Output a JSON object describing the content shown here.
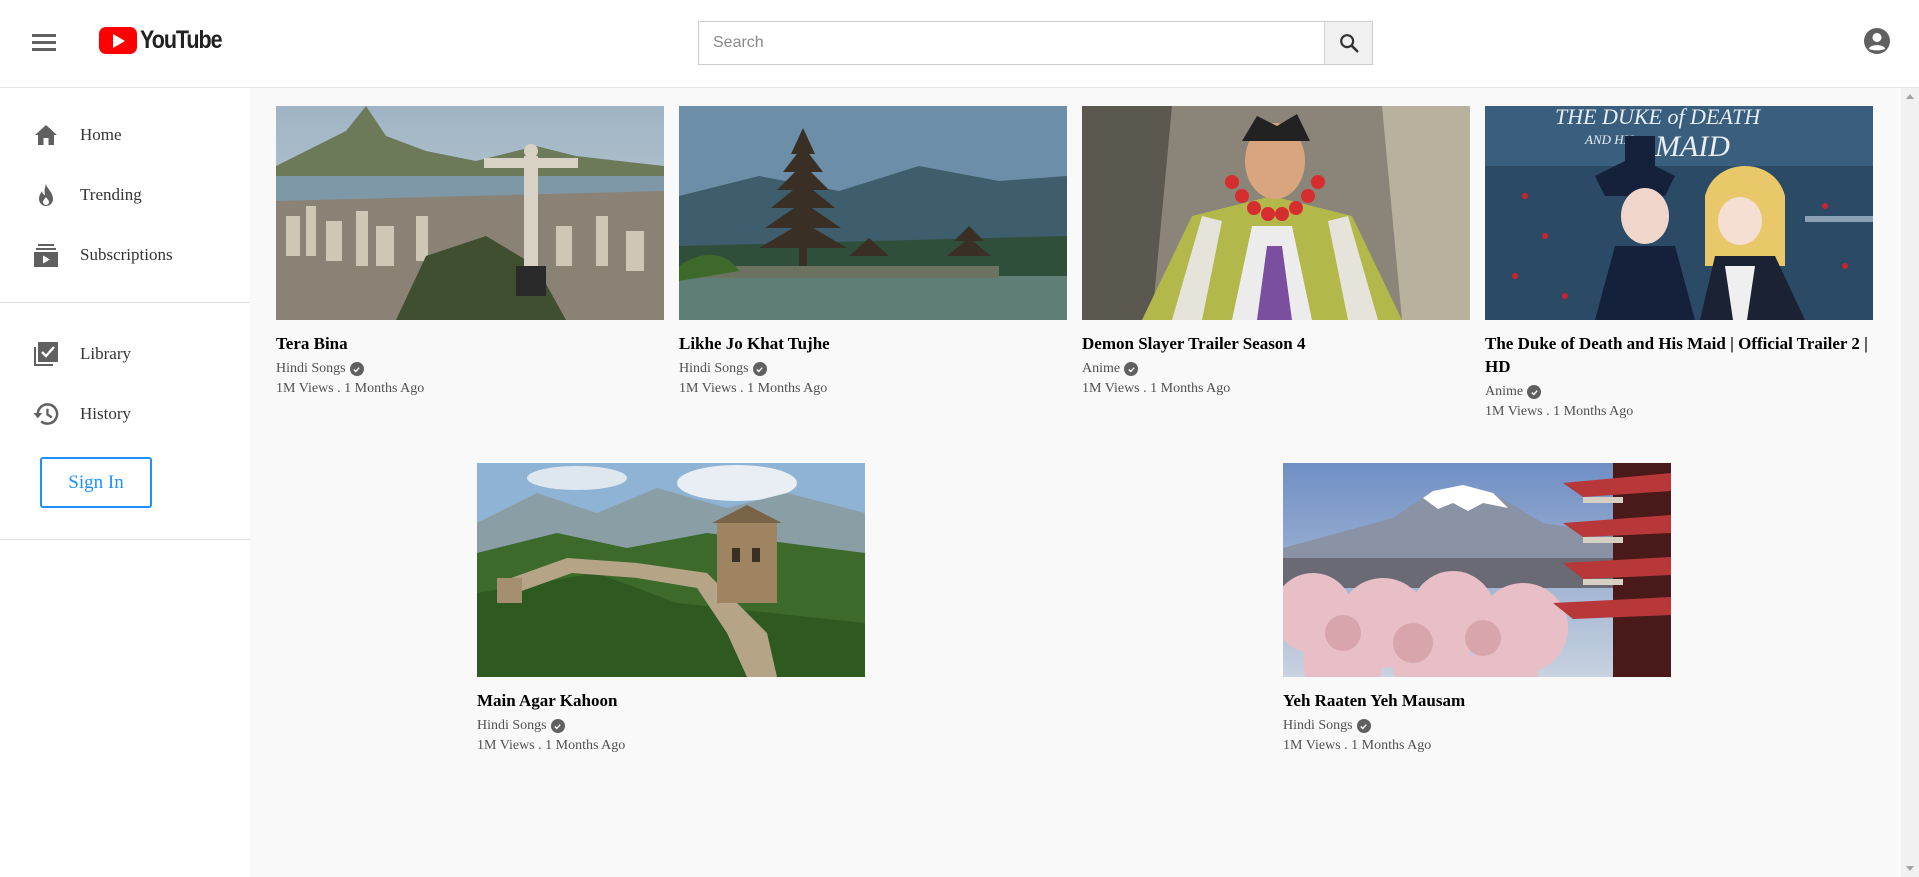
{
  "header": {
    "logo_text": "YouTube",
    "search_placeholder": "Search"
  },
  "sidebar": {
    "items": [
      {
        "label": "Home",
        "icon": "home-icon"
      },
      {
        "label": "Trending",
        "icon": "flame-icon"
      },
      {
        "label": "Subscriptions",
        "icon": "subscriptions-icon"
      },
      {
        "label": "Library",
        "icon": "library-icon"
      },
      {
        "label": "History",
        "icon": "history-icon"
      }
    ],
    "sign_in_label": "Sign In"
  },
  "videos": [
    {
      "title": "Tera Bina",
      "channel": "Hindi Songs",
      "meta": "1M Views . 1 Months Ago"
    },
    {
      "title": "Likhe Jo Khat Tujhe",
      "channel": "Hindi Songs",
      "meta": "1M Views . 1 Months Ago"
    },
    {
      "title": "Demon Slayer Trailer Season 4",
      "channel": "Anime",
      "meta": "1M Views . 1 Months Ago"
    },
    {
      "title": "The Duke of Death and His Maid | Official Trailer 2 | HD",
      "channel": "Anime",
      "meta": "1M Views . 1 Months Ago",
      "thumb_text_1": "THE DUKE of DEATH",
      "thumb_text_2": "AND HIS",
      "thumb_text_3": "MAID"
    },
    {
      "title": "Main Agar Kahoon",
      "channel": "Hindi Songs",
      "meta": "1M Views . 1 Months Ago"
    },
    {
      "title": "Yeh Raaten Yeh Mausam",
      "channel": "Hindi Songs",
      "meta": "1M Views . 1 Months Ago"
    }
  ],
  "colors": {
    "brand_red": "#ff0000",
    "sign_in_blue": "#1e90ff",
    "background": "#f9f9f9"
  }
}
